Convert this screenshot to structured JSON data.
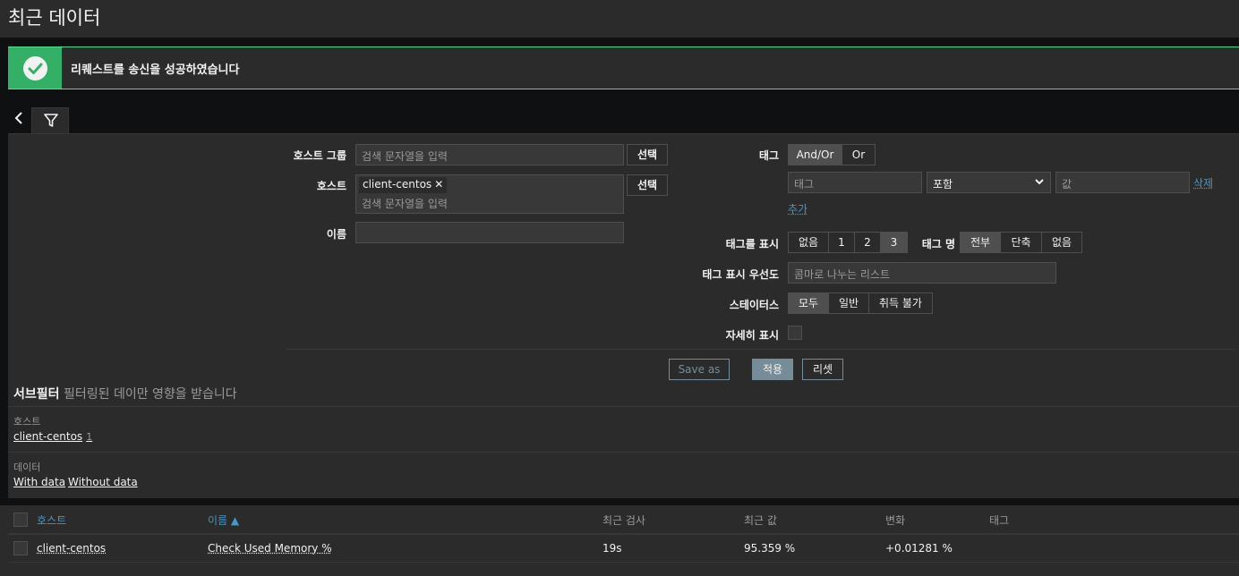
{
  "page": {
    "title": "최근 데이터"
  },
  "message": {
    "text": "리퀘스트를 송신을 성공하였습니다"
  },
  "filter": {
    "host_group_label": "호스트 그룹",
    "host_group_placeholder": "검색 문자열을 입력",
    "host_label": "호스트",
    "host_chip": "client-centos",
    "host_placeholder": "검색 문자열을 입력",
    "select_label": "선택",
    "name_label": "이름",
    "name_value": "",
    "tags_label": "태그",
    "tag_logic": [
      {
        "label": "And/Or",
        "active": true
      },
      {
        "label": "Or",
        "active": false
      }
    ],
    "tag_placeholder": "태그",
    "tag_operator": "포함",
    "tag_value_placeholder": "값",
    "remove_label": "삭제",
    "add_label": "추가",
    "show_tags_label": "태그를 표시",
    "show_tags_options": [
      {
        "label": "없음",
        "active": false
      },
      {
        "label": "1",
        "active": false
      },
      {
        "label": "2",
        "active": false
      },
      {
        "label": "3",
        "active": true
      }
    ],
    "tag_name_label": "태그 명",
    "tag_name_options": [
      {
        "label": "전부",
        "active": true
      },
      {
        "label": "단축",
        "active": false
      },
      {
        "label": "없음",
        "active": false
      }
    ],
    "tag_priority_label": "태그 표시 우선도",
    "tag_priority_placeholder": "콤마로 나누는 리스트",
    "state_label": "스테이터스",
    "state_options": [
      {
        "label": "모두",
        "active": true
      },
      {
        "label": "일반",
        "active": false
      },
      {
        "label": "취득 불가",
        "active": false
      }
    ],
    "details_label": "자세히 표시",
    "details_checked": false,
    "save_as_label": "Save as",
    "apply_label": "적용",
    "reset_label": "리셋"
  },
  "subfilter": {
    "title": "서브필터",
    "note": "필터링된 데이만 영향을 받습니다",
    "hosts_label": "호스트",
    "hosts": [
      {
        "name": "client-centos",
        "count": "1"
      }
    ],
    "data_label": "데이터",
    "data_options": [
      "With data",
      "Without data"
    ]
  },
  "table": {
    "columns": {
      "host": "호스트",
      "name": "이름 ▲",
      "last_check": "최근 검사",
      "last_value": "최근 값",
      "change": "변화",
      "tags": "태그"
    },
    "rows": [
      {
        "host": "client-centos",
        "name": "Check Used Memory %",
        "last_check": "19s",
        "last_value": "95.359 %",
        "change": "+0.01281 %",
        "tags": ""
      }
    ]
  },
  "colors": {
    "success": "#34af67",
    "success_border": "#59db8f",
    "link": "#4796c4",
    "button": "#768d99",
    "background": "#2b2b2b"
  }
}
